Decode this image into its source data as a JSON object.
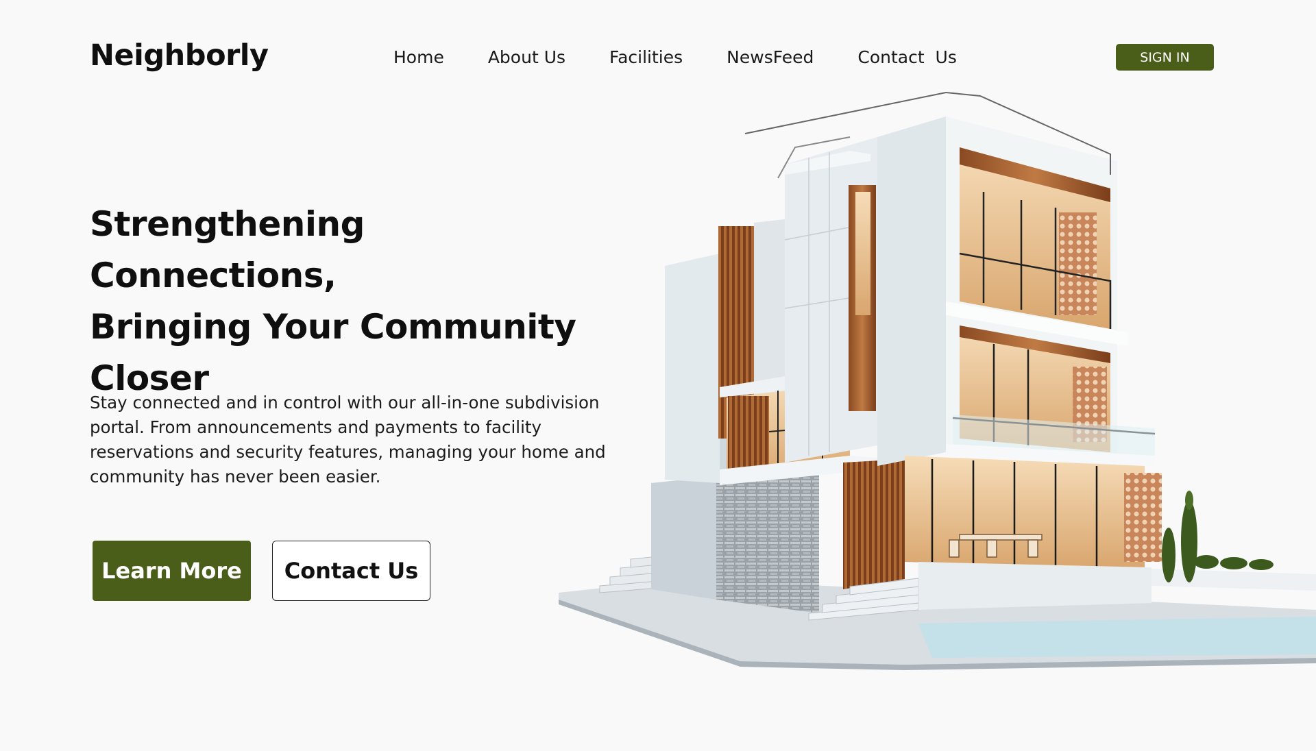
{
  "brand": {
    "name": "Neighborly"
  },
  "nav": {
    "items": [
      {
        "label": "Home"
      },
      {
        "label": "About Us"
      },
      {
        "label": "Facilities"
      },
      {
        "label": "NewsFeed"
      },
      {
        "label": "Contact  Us"
      }
    ],
    "signin_label": "SIGN IN"
  },
  "hero": {
    "headline_line1": "Strengthening Connections,",
    "headline_line2": "Bringing Your Community",
    "headline_line3": "Closer",
    "description": "Stay connected and in control with our all-in-one subdivision portal. From announcements and payments to facility reservations and security features, managing your home and community has never been easier.",
    "learn_more_label": "Learn More",
    "contact_label": "Contact Us"
  },
  "colors": {
    "accent": "#4a5e1a",
    "background": "#f9f9f9",
    "text": "#111111"
  }
}
